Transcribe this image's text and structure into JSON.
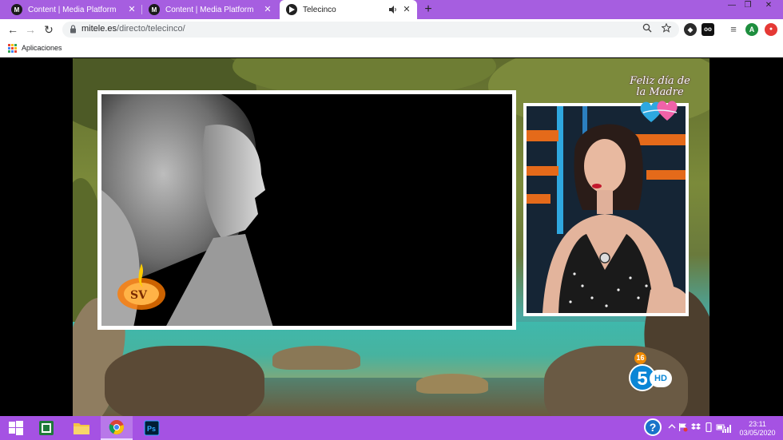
{
  "browser": {
    "tabs": [
      {
        "favicon": "M",
        "title": "Content | Media Platform",
        "active": false
      },
      {
        "favicon": "M",
        "title": "Content | Media Platform",
        "active": false
      },
      {
        "favicon": "T",
        "title": "Telecinco",
        "active": true,
        "audio": "speaker-icon"
      }
    ],
    "close_glyph": "✕",
    "new_tab_glyph": "+",
    "window_controls": {
      "minimize": "—",
      "restore": "❐",
      "close": "✕"
    },
    "toolbar": {
      "back": "←",
      "forward": "→",
      "reload": "↻",
      "url_host": "mitele.es",
      "url_path": "/directo/telecinco/",
      "zoom_icon": "magnifier-icon",
      "star_icon": "star-icon",
      "extensions": [
        {
          "name": "shield-extension-icon",
          "label": "◆",
          "color": "#2b2b2b"
        },
        {
          "name": "oo-extension-icon",
          "label": "oo",
          "color": "#111111"
        },
        {
          "name": "playlist-icon",
          "label": "≡",
          "color": "#555555"
        },
        {
          "name": "profile-avatar",
          "label": "A",
          "color": "#1e8e3e"
        },
        {
          "name": "red-extension-icon",
          "label": "●",
          "color": "#e53935"
        }
      ]
    },
    "bookmarks": {
      "apps_label": "Aplicaciones",
      "apps_colors": [
        "#ea4335",
        "#fbbc04",
        "#34a853",
        "#4285f4",
        "#ea4335",
        "#fbbc04",
        "#34a853",
        "#4285f4",
        "#ea4335"
      ]
    }
  },
  "video": {
    "overlay_line1": "Feliz día de",
    "overlay_line2": "la Madre",
    "age_rating": "16",
    "channel_number": "5",
    "channel_suffix": "HD"
  },
  "taskbar": {
    "apps": [
      {
        "name": "windows-start-icon",
        "active": false
      },
      {
        "name": "excel-icon",
        "active": false
      },
      {
        "name": "file-explorer-icon",
        "active": false
      },
      {
        "name": "chrome-icon",
        "active": true
      },
      {
        "name": "photoshop-icon",
        "label": "Ps",
        "active": false
      }
    ],
    "tray": {
      "help": "?",
      "time": "23:11",
      "date": "03/05/2020"
    }
  },
  "colors": {
    "tabstrip": "#a65ee0",
    "taskbar": "#a552e3",
    "channel_blue": "#0a86d6"
  }
}
